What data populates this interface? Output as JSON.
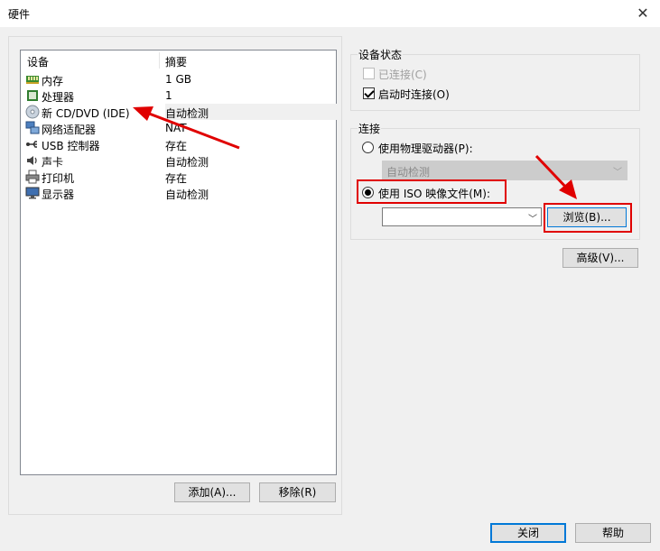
{
  "window": {
    "title": "硬件"
  },
  "list": {
    "col_device": "设备",
    "col_summary": "摘要",
    "rows": [
      {
        "icon": "memory-icon",
        "name": "内存",
        "summary": "1 GB"
      },
      {
        "icon": "processor-icon",
        "name": "处理器",
        "summary": "1"
      },
      {
        "icon": "cd-dvd-icon",
        "name": "新 CD/DVD (IDE)",
        "summary": "自动检测"
      },
      {
        "icon": "network-adapter-icon",
        "name": "网络适配器",
        "summary": "NAT"
      },
      {
        "icon": "usb-icon",
        "name": "USB 控制器",
        "summary": "存在"
      },
      {
        "icon": "sound-icon",
        "name": "声卡",
        "summary": "自动检测"
      },
      {
        "icon": "printer-icon",
        "name": "打印机",
        "summary": "存在"
      },
      {
        "icon": "display-icon",
        "name": "显示器",
        "summary": "自动检测"
      }
    ]
  },
  "buttons": {
    "add": "添加(A)...",
    "remove": "移除(R)",
    "browse": "浏览(B)...",
    "advanced": "高级(V)...",
    "close": "关闭",
    "help": "帮助"
  },
  "device_status": {
    "title": "设备状态",
    "connected": "已连接(C)",
    "connect_at_power_on": "启动时连接(O)"
  },
  "connection": {
    "title": "连接",
    "physical_drive": "使用物理驱动器(P):",
    "physical_drive_value": "自动检测",
    "iso_file": "使用 ISO 映像文件(M):",
    "iso_path": ""
  },
  "colors": {
    "highlight": "#e00000",
    "accent_border": "#0078d7"
  }
}
